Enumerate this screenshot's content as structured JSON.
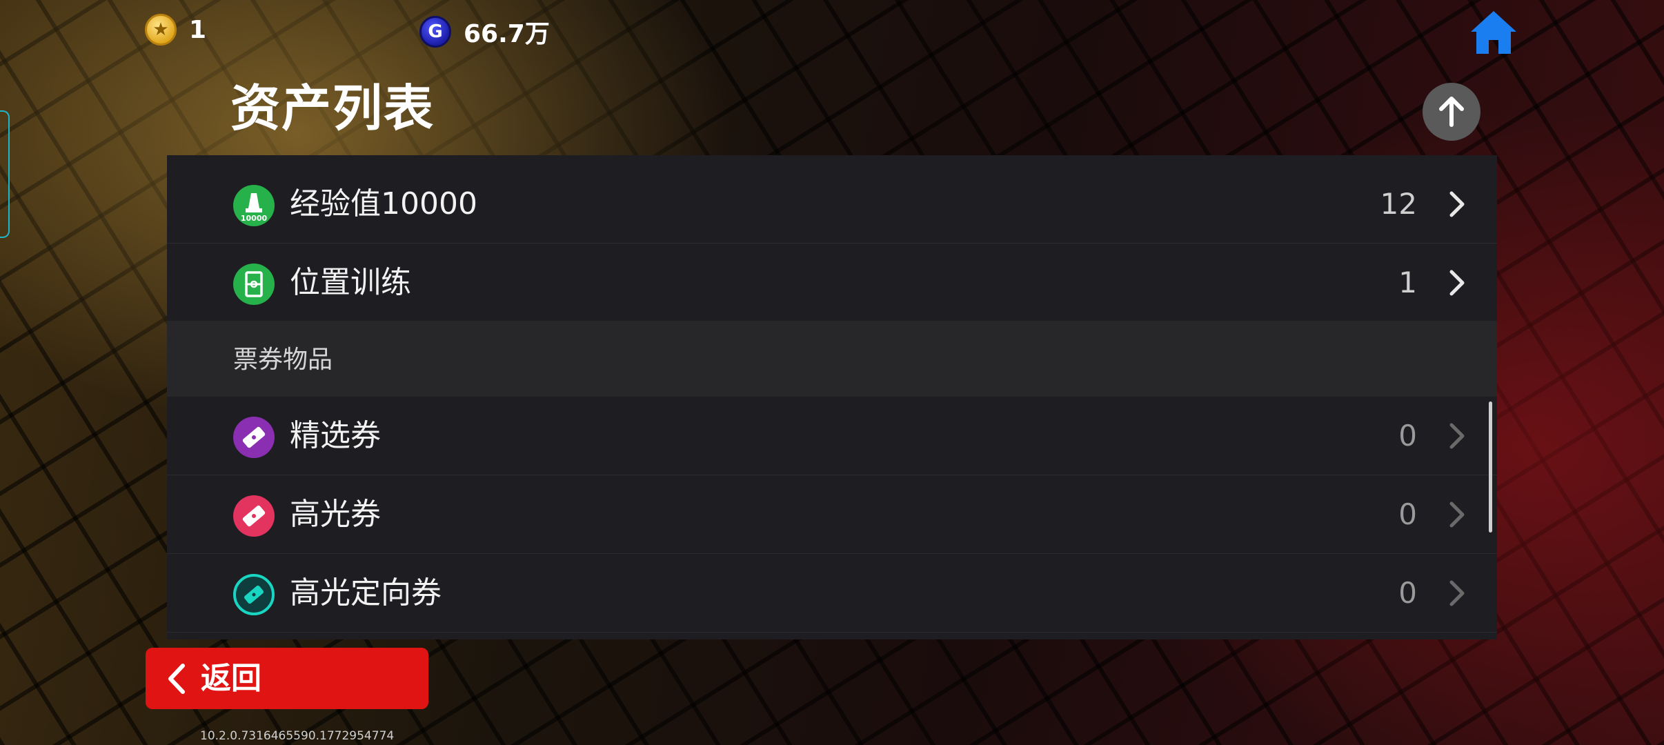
{
  "topbar": {
    "coins_value": "1",
    "gold_value": "66.7万",
    "gold_glyph": "G",
    "star_glyph": "★"
  },
  "page_title": "资产列表",
  "rows_top": [
    {
      "label": "经验值10000",
      "count": "12",
      "icon": "experience-10000-icon",
      "color": "#27b14a"
    },
    {
      "label": "位置训练",
      "count": "1",
      "icon": "position-training-icon",
      "color": "#27b14a"
    }
  ],
  "section": {
    "title": "票券物品"
  },
  "rows_tickets": [
    {
      "label": "精选券",
      "count": "0",
      "icon": "select-ticket-icon",
      "color": "#8b2fb2"
    },
    {
      "label": "高光券",
      "count": "0",
      "icon": "highlight-ticket-icon",
      "color": "#e3335f"
    },
    {
      "label": "高光定向券",
      "count": "0",
      "icon": "highlight-directional-ticket-icon",
      "color": "#0f9b8e"
    }
  ],
  "icon_badge_text": "10000",
  "back_button": {
    "label": "返回",
    "color": "#e11414"
  },
  "version": "10.2.0.7316465590.1772954774"
}
